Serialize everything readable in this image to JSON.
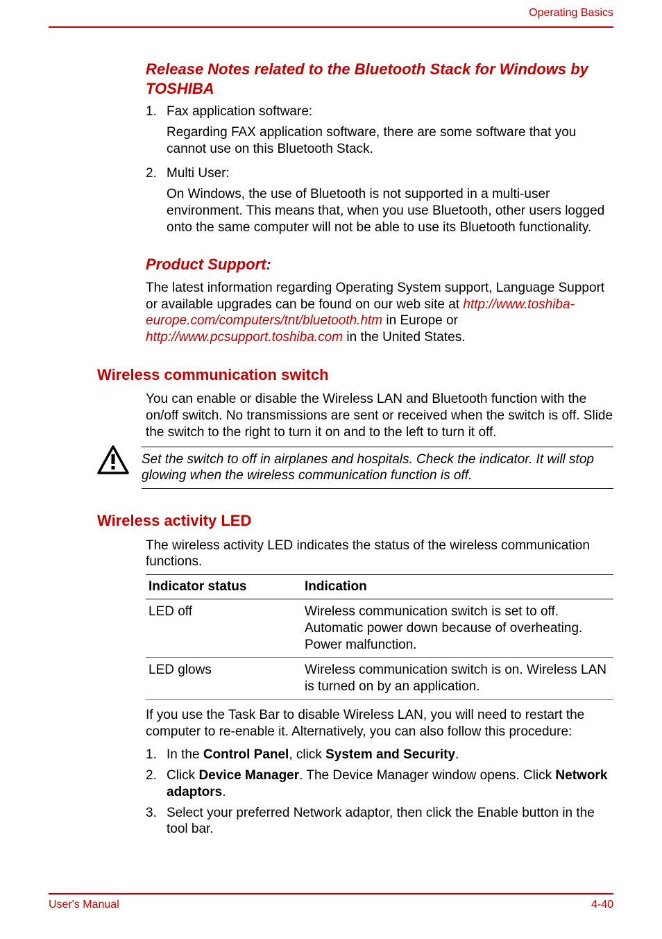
{
  "header": {
    "section": "Operating Basics"
  },
  "h1": "Release Notes related to the Bluetooth Stack for Windows by TOSHIBA",
  "list1": {
    "i1": {
      "marker": "1.",
      "label": "Fax application software:",
      "body": "Regarding FAX application software, there are some software that you cannot use on this Bluetooth Stack."
    },
    "i2": {
      "marker": "2.",
      "label": "Multi User:",
      "body": "On Windows, the use of Bluetooth is not supported in a multi-user environment. This means that, when you use Bluetooth, other users logged onto the same computer will not be able to use its Bluetooth functionality."
    }
  },
  "h2": "Product Support:",
  "support": {
    "lead": "The latest information regarding Operating System support, Language Support or available upgrades can be found on our web site at ",
    "link1": "http://www.toshiba-europe.com/computers/tnt/bluetooth.htm",
    "mid": " in Europe or ",
    "link2": "http://www.pcsupport.toshiba.com",
    "tail": " in the United States."
  },
  "h3": "Wireless communication switch",
  "wcs_body": "You can enable or disable the Wireless LAN and Bluetooth function with the on/off switch. No transmissions are sent or received when the switch is off. Slide the switch to the right to turn it on and to the left to turn it off.",
  "callout": "Set the switch to off in airplanes and hospitals. Check the indicator. It will stop glowing when the wireless communication function is off.",
  "h4": "Wireless activity LED",
  "led_body": "The wireless activity LED indicates the status of the wireless communication functions.",
  "table": {
    "h1": "Indicator status",
    "h2": "Indication",
    "r1c1": "LED off",
    "r1c2": "Wireless communication switch is set to off. Automatic power down because of overheating. Power malfunction.",
    "r2c1": "LED glows",
    "r2c2": "Wireless communication switch is on. Wireless LAN is turned on by an application."
  },
  "after_table": "If you use the Task Bar to disable Wireless LAN, you will need to restart the computer to re-enable it. Alternatively, you can also follow this procedure:",
  "list2": {
    "i1": {
      "marker": "1.",
      "pre": "In the ",
      "b1": "Control Panel",
      "mid": ", click ",
      "b2": "System and Security",
      "post": "."
    },
    "i2": {
      "marker": "2.",
      "pre": "Click ",
      "b1": "Device Manager",
      "mid": ". The Device Manager window opens. Click ",
      "b2": "Network adaptors",
      "post": "."
    },
    "i3": {
      "marker": "3.",
      "text": "Select your preferred Network adaptor, then click the Enable button in the tool bar."
    }
  },
  "footer": {
    "left": "User's Manual",
    "right": "4-40"
  }
}
